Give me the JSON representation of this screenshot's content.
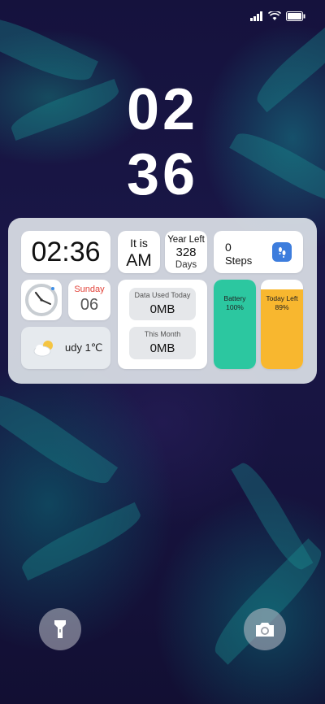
{
  "lockscreen": {
    "hour": "02",
    "minute": "36"
  },
  "widget": {
    "digital_time": "02:36",
    "ampm_prefix": "It is",
    "ampm": "AM",
    "year_left_label": "Year Left",
    "year_left_value": "328",
    "year_left_unit": "Days",
    "steps_value": "0",
    "steps_label": "Steps",
    "weekday": "Sunday",
    "day": "06",
    "weather_text": "udy 1℃",
    "data_used_today_label": "Data Used Today",
    "data_used_today_value": "0MB",
    "this_month_label": "This Month",
    "this_month_value": "0MB",
    "battery_label": "Battery",
    "battery_value": "100%",
    "battery_fraction": 1.0,
    "today_left_label": "Today Left",
    "today_left_value": "89%",
    "today_left_fraction": 0.89
  },
  "colors": {
    "battery_fill": "#2cc7a0",
    "today_left_fill": "#f8b72f",
    "steps_icon_bg": "#3d7ddd",
    "weekday_color": "#e2433a"
  },
  "icons": {
    "flashlight": "flashlight-icon",
    "camera": "camera-icon",
    "signal": "signal-icon",
    "wifi": "wifi-icon",
    "battery": "battery-icon"
  }
}
